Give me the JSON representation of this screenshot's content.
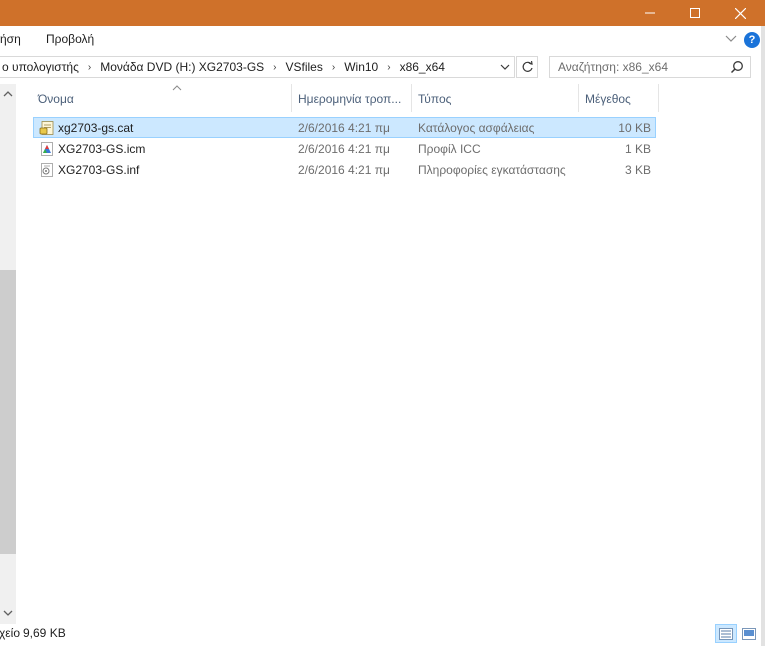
{
  "window": {
    "titlebar_color": "#cf712a",
    "controls": {
      "minimize": "minimize-icon",
      "maximize": "maximize-icon",
      "close": "close-icon"
    }
  },
  "ribbon": {
    "tabs": [
      {
        "label": "ήση"
      },
      {
        "label": "Προβολή"
      }
    ],
    "help_label": "?"
  },
  "address": {
    "crumbs": [
      "ο υπολογιστής",
      "Μονάδα DVD (H:) XG2703-GS",
      "VSfiles",
      "Win10",
      "x86_x64"
    ],
    "separator": "›"
  },
  "search": {
    "placeholder": "Αναζήτηση: x86_x64"
  },
  "columns": {
    "name": "Όνομα",
    "date": "Ημερομηνία τροπ...",
    "type": "Τύπος",
    "size": "Μέγεθος"
  },
  "files": [
    {
      "name": "xg2703-gs.cat",
      "date": "2/6/2016 4:21 πμ",
      "type": "Κατάλογος ασφάλειας",
      "size": "10 KB",
      "icon": "security-catalog-icon",
      "selected": true
    },
    {
      "name": "XG2703-GS.icm",
      "date": "2/6/2016 4:21 πμ",
      "type": "Προφίλ ICC",
      "size": "1 KB",
      "icon": "color-profile-icon",
      "selected": false
    },
    {
      "name": "XG2703-GS.inf",
      "date": "2/6/2016 4:21 πμ",
      "type": "Πληροφορίες εγκατάστασης",
      "size": "3 KB",
      "icon": "setup-info-icon",
      "selected": false
    }
  ],
  "status": {
    "count_text": "χείο",
    "size_text": "9,69 KB"
  },
  "colors": {
    "selection_bg": "#cce8ff",
    "selection_border": "#99d1ff",
    "header_text": "#4c607a"
  }
}
